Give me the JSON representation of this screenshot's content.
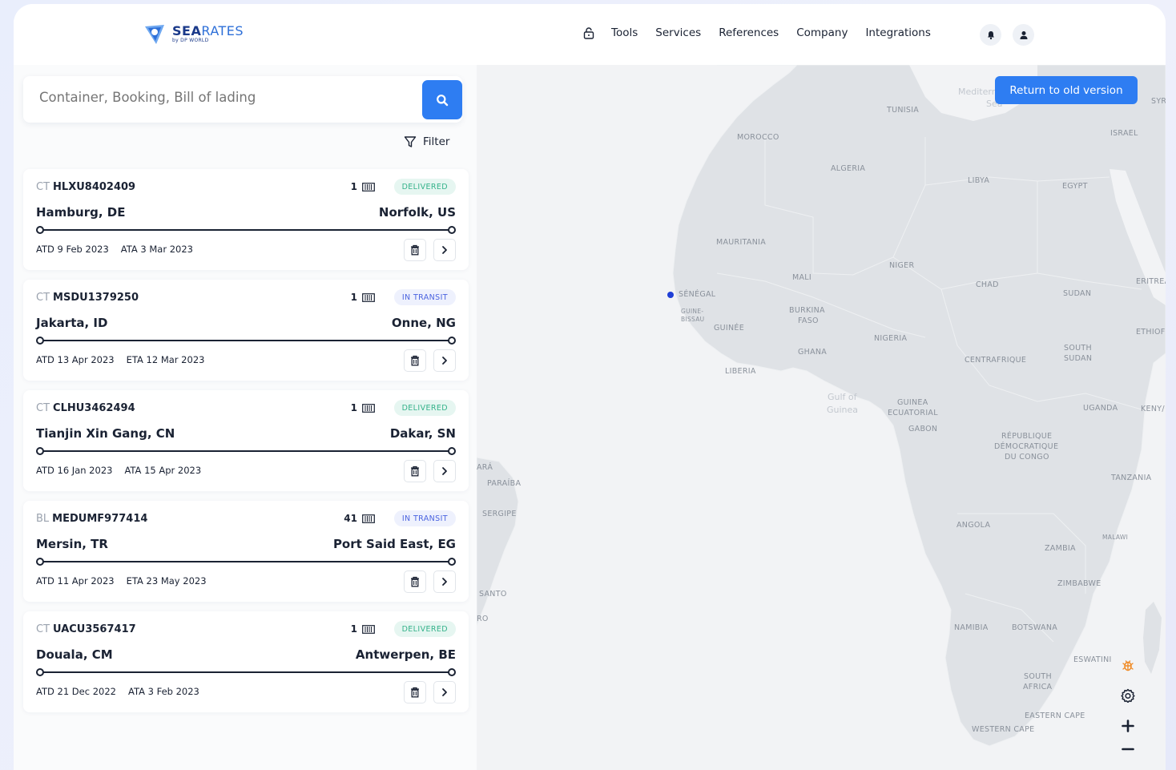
{
  "brand": {
    "name_bold": "SEA",
    "name_rest": "RATES",
    "sub": "by DP WORLD"
  },
  "nav": [
    "Tools",
    "Services",
    "References",
    "Company",
    "Integrations"
  ],
  "search": {
    "placeholder": "Container, Booking, Bill of lading"
  },
  "filter_label": "Filter",
  "return_button": "Return to old version",
  "shipments": [
    {
      "type": "CT",
      "id": "HLXU8402409",
      "count": "1",
      "status": "DELIVERED",
      "from": "Hamburg, DE",
      "to": "Norfolk, US",
      "atd": "ATD 9 Feb 2023",
      "arrival": "ATA 3 Mar 2023"
    },
    {
      "type": "CT",
      "id": "MSDU1379250",
      "count": "1",
      "status": "IN TRANSIT",
      "from": "Jakarta, ID",
      "to": "Onne, NG",
      "atd": "ATD 13 Apr 2023",
      "arrival": "ETA 12 Mar 2023"
    },
    {
      "type": "CT",
      "id": "CLHU3462494",
      "count": "1",
      "status": "DELIVERED",
      "from": "Tianjin Xin Gang, CN",
      "to": "Dakar, SN",
      "atd": "ATD 16 Jan 2023",
      "arrival": "ATA 15 Apr 2023"
    },
    {
      "type": "BL",
      "id": "MEDUMF977414",
      "count": "41",
      "status": "IN TRANSIT",
      "from": "Mersin, TR",
      "to": "Port Said East, EG",
      "atd": "ATD 11 Apr 2023",
      "arrival": "ETA 23 May 2023"
    },
    {
      "type": "CT",
      "id": "UACU3567417",
      "count": "1",
      "status": "DELIVERED",
      "from": "Douala, CM",
      "to": "Antwerpen, BE",
      "atd": "ATD 21 Dec 2022",
      "arrival": "ATA 3 Feb 2023"
    }
  ],
  "map_labels": {
    "mediterranean": "Mediterra",
    "sea": "Sea",
    "tunisia": "TUNISIA",
    "israel": "ISRAEL",
    "syria": "SYRI",
    "morocco": "MOROCCO",
    "algeria": "ALGERIA",
    "libya": "LIBYA",
    "egypt": "EGYPT",
    "mauritania": "MAURITANIA",
    "mali": "MALI",
    "niger": "NIGER",
    "chad": "CHAD",
    "sudan": "SUDAN",
    "eritrea": "ERITREA",
    "senegal": "SÉNÉGAL",
    "guinea_bissau_1": "GUINE-",
    "guinea_bissau_2": "BISSAU",
    "guinee": "GUINÉE",
    "burkina_1": "BURKINA",
    "burkina_2": "FASO",
    "nigeria": "NIGERIA",
    "ghana": "GHANA",
    "liberia": "LIBERIA",
    "ethiopia": "ETHIOF",
    "south_sudan_1": "SOUTH",
    "south_sudan_2": "SUDAN",
    "centrafrique": "CENTRAFRIQUE",
    "gulf_1": "Gulf of",
    "gulf_2": "Guinea",
    "eq_guinea_1": "GUINEA",
    "eq_guinea_2": "ECUATORIAL",
    "gabon": "GABON",
    "uganda": "UGANDA",
    "kenya": "KENY/",
    "drc_1": "RÉPUBLIQUE",
    "drc_2": "DÉMOCRATIQUE",
    "drc_3": "DU CONGO",
    "tanzania": "TANZANIA",
    "ara": "ARÁ",
    "paraiba": "PARAÍBA",
    "sergipe": "SERGIPE",
    "santo": "SANTO",
    "ro": "RO",
    "angola": "ANGOLA",
    "malawi": "MALAWI",
    "zambia": "ZAMBIA",
    "zimbabwe": "ZIMBABWE",
    "namibia": "NAMIBIA",
    "botswana": "BOTSWANA",
    "eswatini": "ESWATINI",
    "south_africa_1": "SOUTH",
    "south_africa_2": "AFRICA",
    "eastern_cape": "EASTERN CAPE",
    "western_cape": "WESTERN CAPE"
  },
  "colors": {
    "accent": "#2e7df2",
    "delivered": "#34b28a",
    "in_transit": "#4a63e0",
    "marker": "#1f3fd6"
  }
}
